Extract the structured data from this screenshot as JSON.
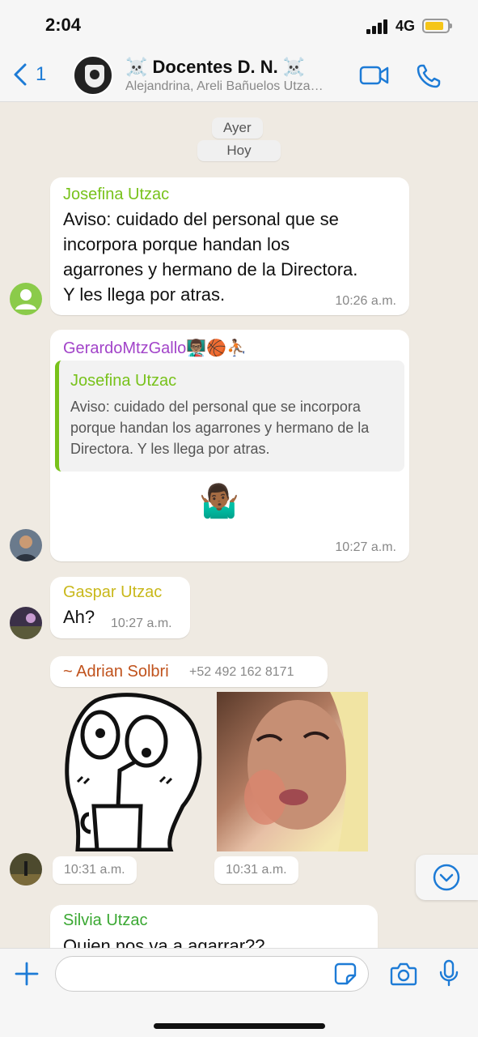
{
  "status": {
    "time": "2:04",
    "network": "4G"
  },
  "header": {
    "back_count": "1",
    "title": "☠️ Docentes D. N. ☠️",
    "subtitle": "Alejandrina, Areli Bañuelos Utza…"
  },
  "chat": {
    "date_pills": [
      "Ayer",
      "Hoy"
    ],
    "messages": [
      {
        "sender": "Josefina Utzac",
        "sender_color": "#78c21b",
        "lines": [
          "Aviso: cuidado del personal que se",
          "incorpora porque handan los",
          "agarrones  y hermano de la Directora.",
          "Y les llega por atras."
        ],
        "time": "10:26 a.m."
      },
      {
        "sender": "GerardoMtzGallo👨🏽‍🏫🏀⛹🏽",
        "sender_color": "#a244c9",
        "quote_name": "Josefina Utzac",
        "quote_lines": [
          "Aviso: cuidado del personal que se incorpora",
          "porque handan los agarrones  y hermano de la",
          "Directora. Y les llega por atras."
        ],
        "emoji": "🤷🏾‍♂️",
        "time": "10:27 a.m."
      },
      {
        "sender": "Gaspar Utzac",
        "sender_color": "#c9b81b",
        "text": "Ah?",
        "time": "10:27 a.m."
      },
      {
        "sender": "~ Adrian Solbri",
        "sender_color": "#c0521c",
        "phone": "+52 492 162 8171",
        "time_sticker": "10:31 a.m.",
        "time_image": "10:31 a.m."
      },
      {
        "sender": "Silvia Utzac",
        "sender_color": "#3aa832",
        "text": "Quien nos va a agarrar??"
      }
    ]
  },
  "composer": {
    "placeholder": ""
  },
  "icons": {
    "back": "chevron-left-icon",
    "video": "video-call-icon",
    "call": "phone-icon",
    "add": "plus-icon",
    "sticker": "sticker-icon",
    "camera": "camera-icon",
    "mic": "microphone-icon",
    "scroll": "scroll-down-icon"
  },
  "colors": {
    "accent": "#1d7bd6",
    "chat_bg": "#efeae2"
  }
}
